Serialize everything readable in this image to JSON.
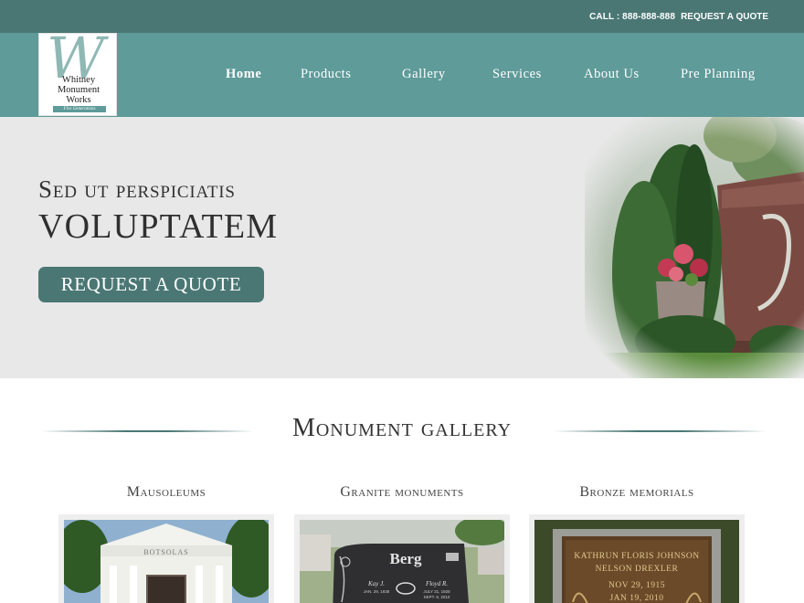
{
  "topbar": {
    "call": "CALL : 888-888-888",
    "request_quote": "REQUEST A QUOTE"
  },
  "logo": {
    "initial": "W",
    "line1": "Whitney",
    "line2": "Monument",
    "line3": "Works",
    "tagline": "Five Generations"
  },
  "nav": {
    "items": [
      {
        "label": "Home",
        "active": true
      },
      {
        "label": "Products"
      },
      {
        "label": "Gallery"
      },
      {
        "label": "Services"
      },
      {
        "label": "About Us"
      },
      {
        "label": "Pre Planning"
      }
    ]
  },
  "hero": {
    "subtitle": "Sed ut perspiciatis",
    "title": "VOLUPTATEM",
    "button": "REQUEST A QUOTE"
  },
  "gallery": {
    "title": "Monument gallery",
    "cards": [
      {
        "caption": "Mausoleums",
        "image_text": "BOTSOLAS"
      },
      {
        "caption": "Granite monuments",
        "image_text": "Berg",
        "left_name": "Kay J.",
        "left_date": "JAN. 29, 1938",
        "right_name": "Floyd R.",
        "right_date1": "JULY 31, 1928",
        "right_date2": "SEPT. 8, 2010"
      },
      {
        "caption": "Bronze memorials",
        "line1": "KATHRUN FLORIS JOHNSON",
        "line2": "NELSON DREXLER",
        "line3": "NOV 29, 1915",
        "line4": "JAN 19, 2010"
      }
    ]
  },
  "colors": {
    "topbar": "#4a7774",
    "nav": "#5e9b99",
    "button": "#4a7774",
    "hero_bg": "#e8e8e8"
  }
}
